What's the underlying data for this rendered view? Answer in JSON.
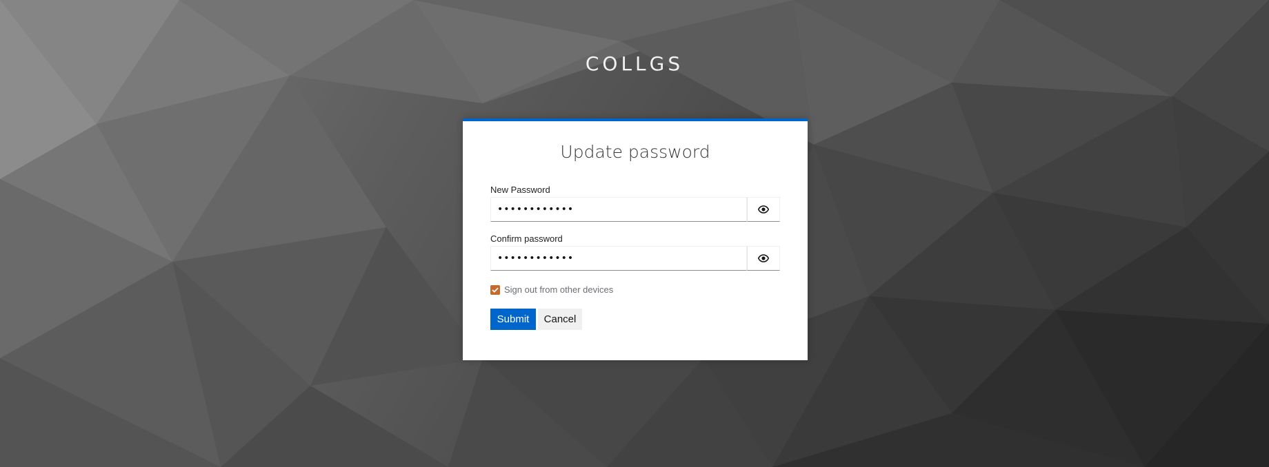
{
  "brand": {
    "title": "COLLGS"
  },
  "card": {
    "title": "Update password",
    "new_password": {
      "label": "New Password",
      "value": "••••••••••••"
    },
    "confirm_password": {
      "label": "Confirm password",
      "value": "••••••••••••"
    },
    "sign_out_other_devices": {
      "label": "Sign out from other devices",
      "checked": true
    },
    "submit_label": "Submit",
    "cancel_label": "Cancel"
  },
  "icons": {
    "show_password": "eye-icon",
    "checkbox_mark": "checkmark-icon"
  },
  "colors": {
    "accent": "#0066cc",
    "checkbox": "#c46a2c"
  }
}
